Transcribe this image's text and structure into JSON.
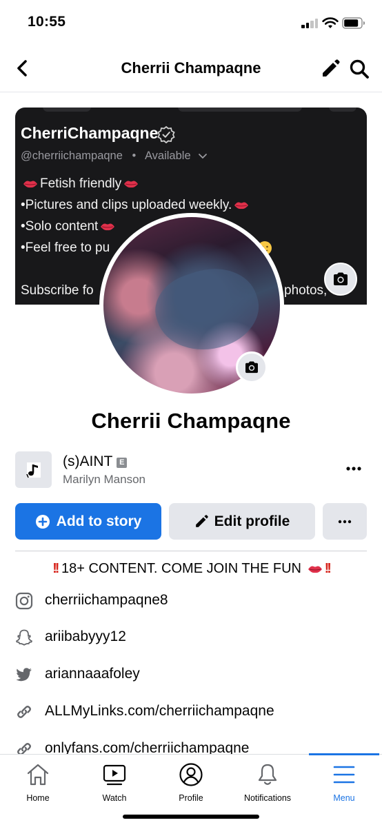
{
  "status_bar": {
    "time": "10:55"
  },
  "nav": {
    "title": "Cherrii Champaqne",
    "back_icon": "chevron-left-icon",
    "edit_icon": "pencil-icon",
    "search_icon": "search-icon"
  },
  "cover": {
    "name": "CherriChampaqne",
    "handle": "@cherriichampaqne",
    "separator": "•",
    "availability": "Available",
    "lines": {
      "l1": "Fetish friendly",
      "l2": "•Pictures and clips uploaded weekly.",
      "l3": "•Solo content",
      "l4a": "•Feel free to pu",
      "l5a": "Subscribe fo",
      "l5b": "photos,"
    }
  },
  "profile": {
    "name": "Cherrii Champaqne"
  },
  "song": {
    "title": "(s)AINT",
    "explicit": "E",
    "artist": "Marilyn Manson"
  },
  "buttons": {
    "add_story": "Add to story",
    "edit_profile": "Edit profile"
  },
  "bio": {
    "text": " 18+ CONTENT. COME JOIN THE FUN ",
    "bang": "!!"
  },
  "links": [
    {
      "icon": "instagram-icon",
      "text": "cherriichampaqne8"
    },
    {
      "icon": "snapchat-icon",
      "text": "ariibabyyy12"
    },
    {
      "icon": "twitter-icon",
      "text": "ariannaaafoley"
    },
    {
      "icon": "link-icon",
      "text": "ALLMyLinks.com/cherriichampaqne"
    },
    {
      "icon": "link-icon",
      "text": "onlyfans.com/cherriichampaqne"
    }
  ],
  "tabs": [
    {
      "label": "Home",
      "icon": "home-icon"
    },
    {
      "label": "Watch",
      "icon": "video-icon"
    },
    {
      "label": "Profile",
      "icon": "profile-icon"
    },
    {
      "label": "Notifications",
      "icon": "bell-icon"
    },
    {
      "label": "Menu",
      "icon": "menu-icon",
      "active": true
    }
  ],
  "colors": {
    "accent": "#1b74e4",
    "cover_bg": "#18181a",
    "bang_red": "#d7261e",
    "secondary_text": "#65676b"
  }
}
